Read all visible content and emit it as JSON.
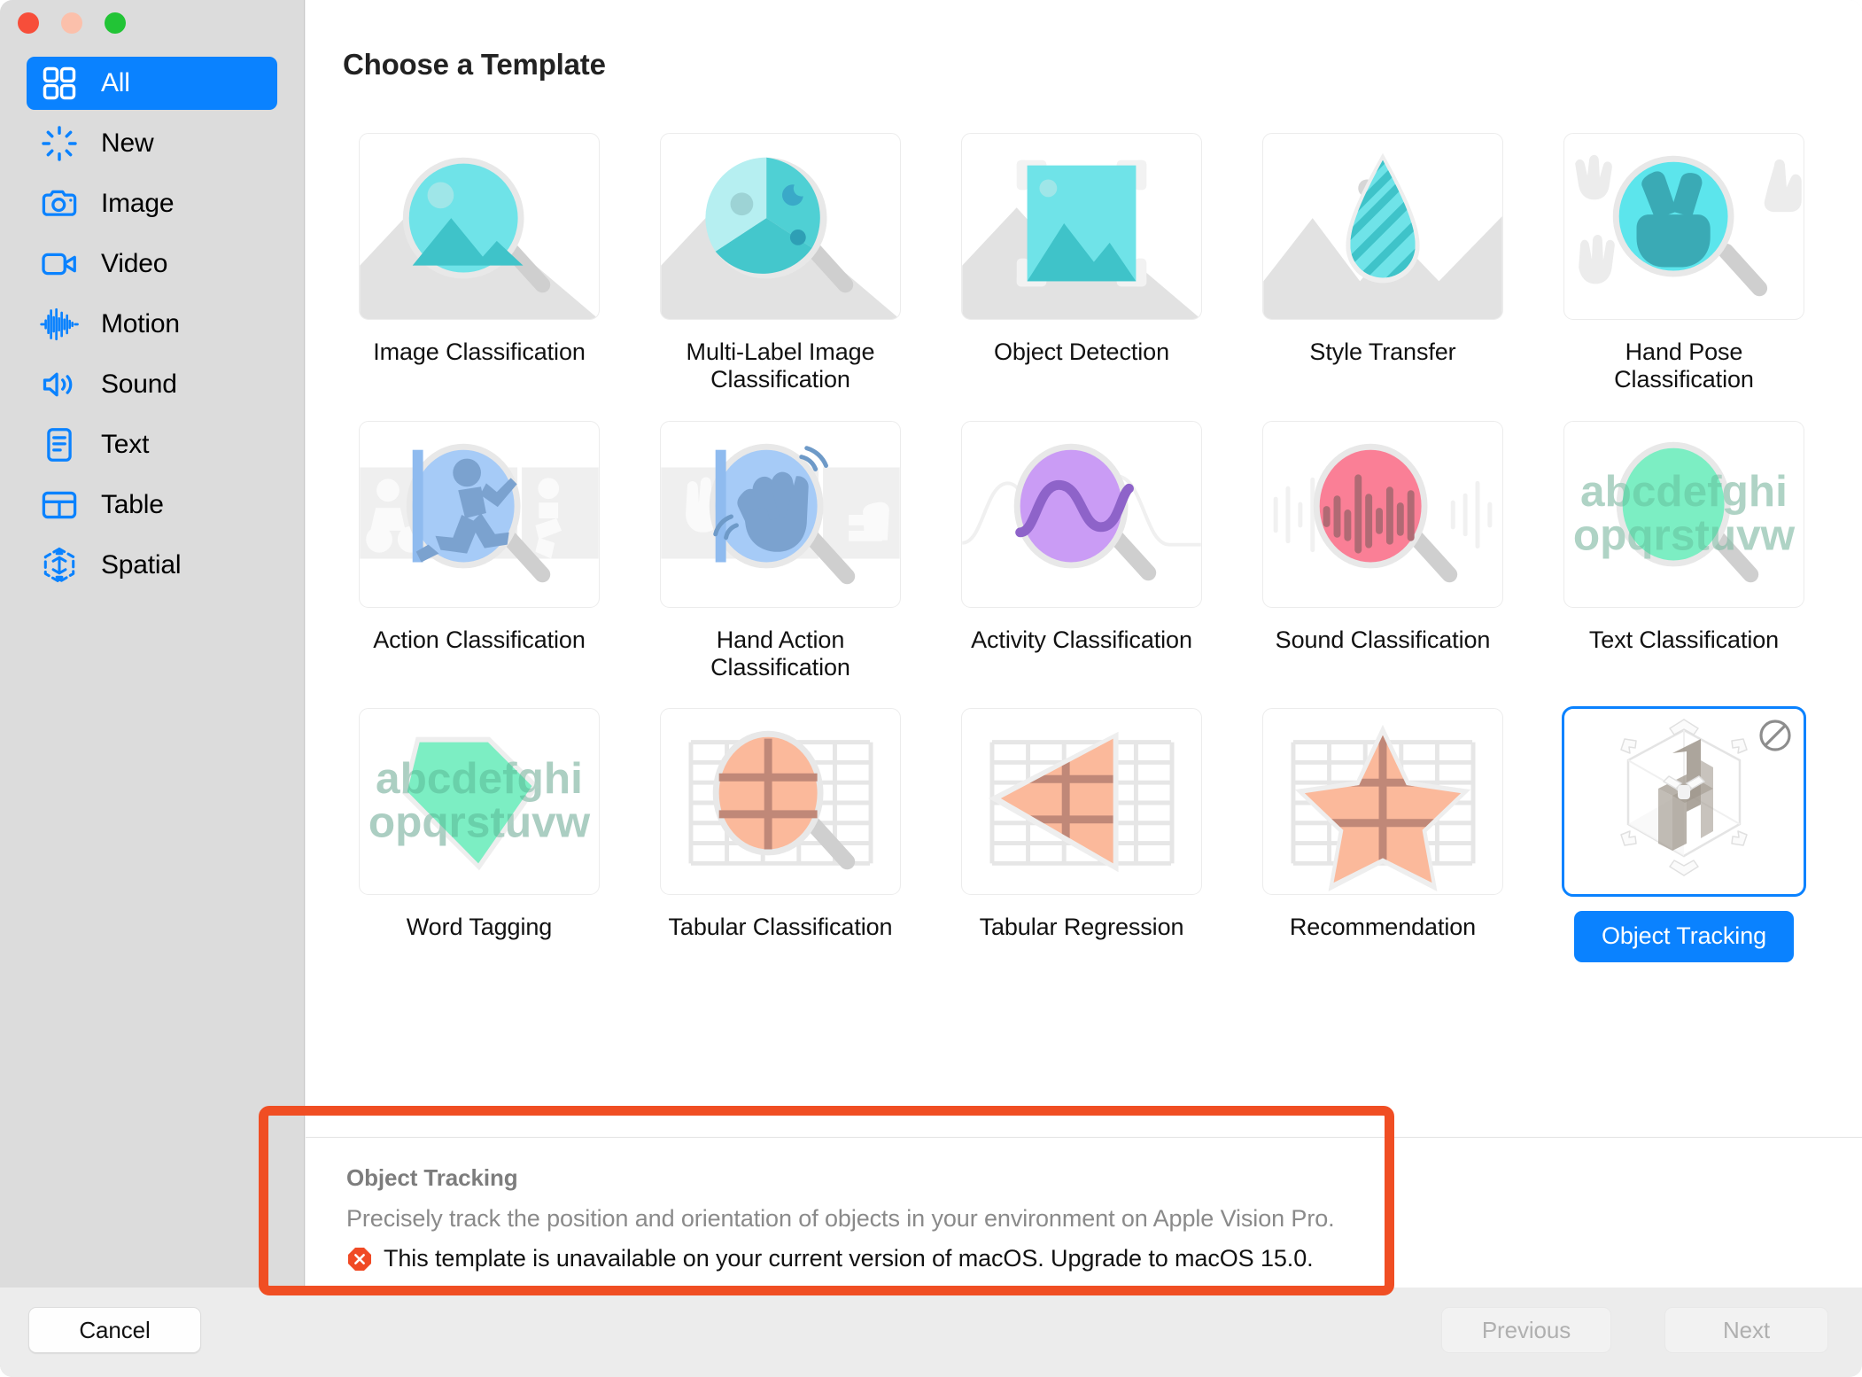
{
  "window": {
    "traffic_lights": [
      "close",
      "minimize",
      "zoom"
    ]
  },
  "sidebar": {
    "items": [
      {
        "label": "All",
        "icon": "grid-icon",
        "selected": true
      },
      {
        "label": "New",
        "icon": "sparkle-icon",
        "selected": false
      },
      {
        "label": "Image",
        "icon": "camera-icon",
        "selected": false
      },
      {
        "label": "Video",
        "icon": "video-icon",
        "selected": false
      },
      {
        "label": "Motion",
        "icon": "waveform-icon",
        "selected": false
      },
      {
        "label": "Sound",
        "icon": "speaker-icon",
        "selected": false
      },
      {
        "label": "Text",
        "icon": "document-icon",
        "selected": false
      },
      {
        "label": "Table",
        "icon": "table-icon",
        "selected": false
      },
      {
        "label": "Spatial",
        "icon": "cube-icon",
        "selected": false
      }
    ]
  },
  "main": {
    "title": "Choose a Template",
    "templates": [
      {
        "label": "Image Classification",
        "art": "image-classification",
        "selected": false,
        "unavailable": false
      },
      {
        "label": "Multi-Label Image Classification",
        "art": "multilabel-classification",
        "selected": false,
        "unavailable": false
      },
      {
        "label": "Object Detection",
        "art": "object-detection",
        "selected": false,
        "unavailable": false
      },
      {
        "label": "Style Transfer",
        "art": "style-transfer",
        "selected": false,
        "unavailable": false
      },
      {
        "label": "Hand Pose Classification",
        "art": "hand-pose",
        "selected": false,
        "unavailable": false
      },
      {
        "label": "Action Classification",
        "art": "action-classification",
        "selected": false,
        "unavailable": false
      },
      {
        "label": "Hand Action Classification",
        "art": "hand-action",
        "selected": false,
        "unavailable": false
      },
      {
        "label": "Activity Classification",
        "art": "activity-classification",
        "selected": false,
        "unavailable": false
      },
      {
        "label": "Sound Classification",
        "art": "sound-classification",
        "selected": false,
        "unavailable": false
      },
      {
        "label": "Text Classification",
        "art": "text-classification",
        "selected": false,
        "unavailable": false
      },
      {
        "label": "Word Tagging",
        "art": "word-tagging",
        "selected": false,
        "unavailable": false
      },
      {
        "label": "Tabular Classification",
        "art": "tabular-classification",
        "selected": false,
        "unavailable": false
      },
      {
        "label": "Tabular Regression",
        "art": "tabular-regression",
        "selected": false,
        "unavailable": false
      },
      {
        "label": "Recommendation",
        "art": "recommendation",
        "selected": false,
        "unavailable": false
      },
      {
        "label": "Object Tracking",
        "art": "object-tracking",
        "selected": true,
        "unavailable": true
      }
    ]
  },
  "detail": {
    "title": "Object Tracking",
    "description": "Precisely track the position and orientation of objects in your environment on Apple Vision Pro.",
    "warning": "This template is unavailable on your current version of macOS. Upgrade to macOS 15.0.",
    "warning_icon": "error-octagon-icon"
  },
  "footer": {
    "cancel_label": "Cancel",
    "previous_label": "Previous",
    "next_label": "Next",
    "previous_disabled": true,
    "next_disabled": true
  },
  "colors": {
    "accent_blue": "#0a82ff",
    "sidebar_bg": "#dcdcdc",
    "annotation_red": "#f04e23",
    "error_red": "#f04a25"
  }
}
